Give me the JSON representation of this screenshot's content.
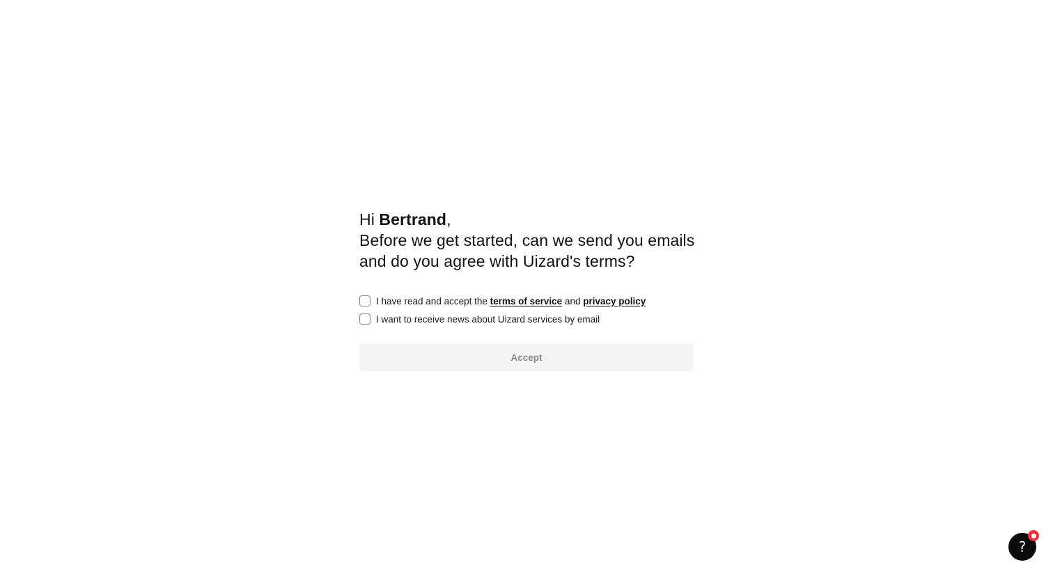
{
  "onboarding": {
    "greeting_prefix": "Hi ",
    "user_name": "Bertrand",
    "greeting_suffix": ",",
    "question_line1": "Before we get started, can we send you emails",
    "question_line2": "and do you agree with Uizard's terms?",
    "terms_consent": {
      "prefix": "I have read and accept the ",
      "terms_link": "terms of service",
      "middle": " and ",
      "privacy_link": "privacy policy",
      "checked": false
    },
    "news_consent": {
      "label": "I want to receive news about Uizard services by email",
      "checked": false
    },
    "accept_label": "Accept",
    "accept_enabled": false
  },
  "help": {
    "label": "?",
    "icon": "help-question-icon",
    "has_notification": true
  },
  "colors": {
    "text": "#111111",
    "button_disabled_bg": "#f4f4f4",
    "button_disabled_text": "#8c8c8c",
    "help_bg": "#0b0b0b",
    "notification": "#e8323a"
  }
}
